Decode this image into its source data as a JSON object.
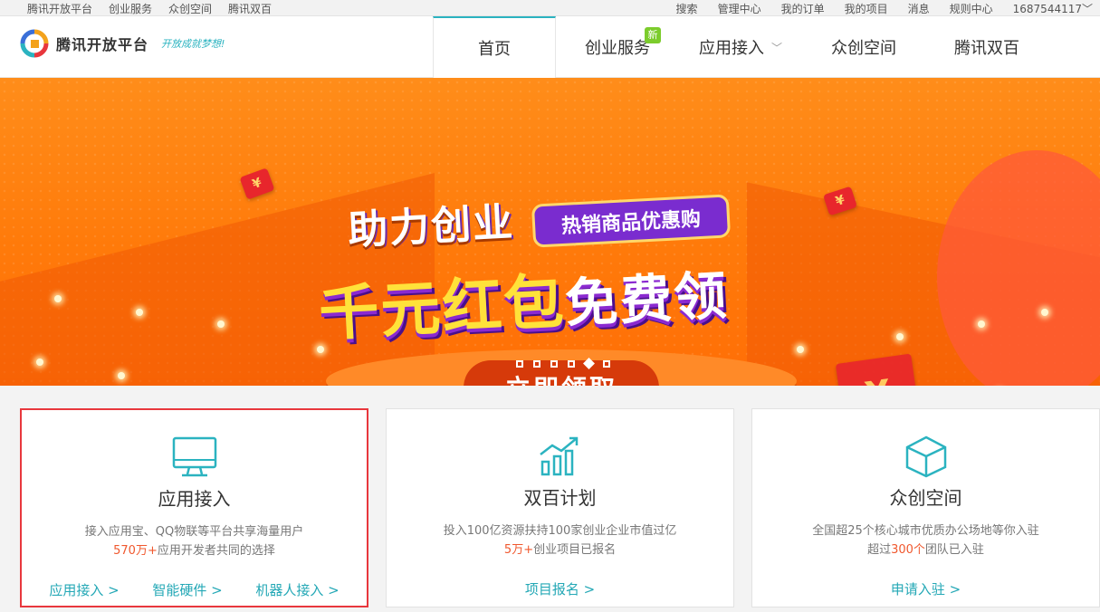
{
  "topbar": {
    "left": [
      "腾讯开放平台",
      "创业服务",
      "众创空间",
      "腾讯双百"
    ],
    "right": [
      "搜索",
      "管理中心",
      "我的订单",
      "我的项目",
      "消息",
      "规则中心",
      "1687544117﹀"
    ]
  },
  "logo": {
    "text": "腾讯开放平台",
    "slogan": "开放成就梦想!"
  },
  "nav": {
    "items": [
      {
        "label": "首页"
      },
      {
        "label": "创业服务",
        "badge": "新"
      },
      {
        "label": "应用接入"
      },
      {
        "label": "众创空间"
      },
      {
        "label": "腾讯双百"
      }
    ],
    "chevron": "﹀"
  },
  "banner": {
    "headline1": "助力创业",
    "pill": "热销商品优惠购",
    "headline2a": "千元红包",
    "headline2b": "免费领",
    "cta": "立即领取",
    "currency_glyph": "¥",
    "slides_total": 6,
    "slide_active": 5
  },
  "cards": [
    {
      "title": "应用接入",
      "desc1": "接入应用宝、QQ物联等平台共享海量用户",
      "desc2_hl": "570万+",
      "desc2": "应用开发者共同的选择",
      "links": [
        "应用接入 >",
        "智能硬件 >",
        "机器人接入 >"
      ],
      "icon": "monitor-icon",
      "selected": true
    },
    {
      "title": "双百计划",
      "desc1": "投入100亿资源扶持100家创业企业市值过亿",
      "desc2_hl": "5万+",
      "desc2": "创业项目已报名",
      "links": [
        "项目报名 >"
      ],
      "icon": "growth-chart-icon",
      "selected": false
    },
    {
      "title": "众创空间",
      "desc1": "全国超25个核心城市优质办公场地等你入驻",
      "desc2_pre": "超过",
      "desc2_hl": "300个",
      "desc2": "团队已入驻",
      "links": [
        "申请入驻 >"
      ],
      "icon": "cube-icon",
      "selected": false
    }
  ],
  "colors": {
    "accent": "#2bb3c0",
    "highlight": "#f0582e",
    "selection": "#e8373d",
    "banner": "#ff7a0a"
  }
}
